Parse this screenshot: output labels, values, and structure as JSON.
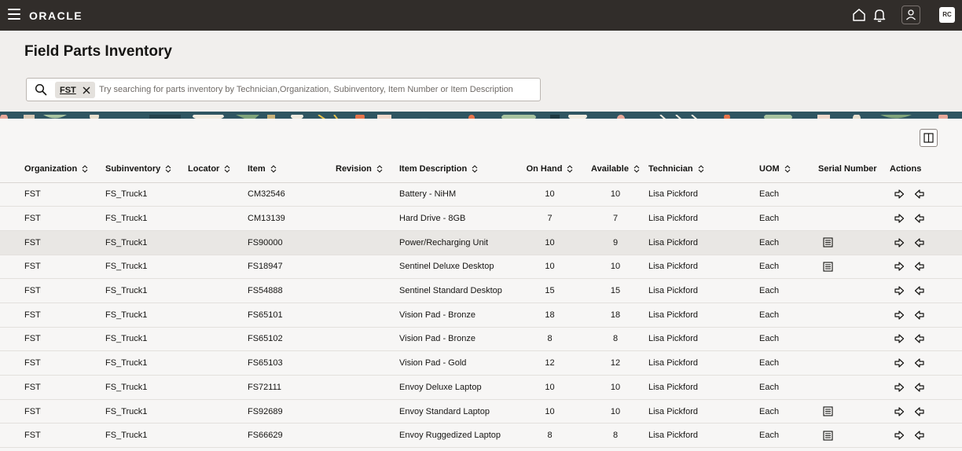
{
  "app": {
    "logo": "ORACLE",
    "avatar_initials": "RC"
  },
  "page": {
    "title": "Field Parts Inventory"
  },
  "search": {
    "chip_label": "FST",
    "placeholder": "Try searching for parts inventory by Technician,Organization, Subinventory, Item Number or Item Description",
    "value": ""
  },
  "table": {
    "headers": {
      "organization": "Organization",
      "subinventory": "Subinventory",
      "locator": "Locator",
      "item": "Item",
      "revision": "Revision",
      "item_description": "Item Description",
      "on_hand": "On Hand",
      "available": "Available",
      "technician": "Technician",
      "uom": "UOM",
      "serial_number": "Serial Number",
      "actions": "Actions"
    },
    "rows": [
      {
        "organization": "FST",
        "subinventory": "FS_Truck1",
        "locator": "",
        "item": "CM32546",
        "revision": "",
        "description": "Battery - NiHM",
        "on_hand": "10",
        "available": "10",
        "technician": "Lisa Pickford",
        "uom": "Each",
        "serial": false
      },
      {
        "organization": "FST",
        "subinventory": "FS_Truck1",
        "locator": "",
        "item": "CM13139",
        "revision": "",
        "description": "Hard Drive - 8GB",
        "on_hand": "7",
        "available": "7",
        "technician": "Lisa Pickford",
        "uom": "Each",
        "serial": false
      },
      {
        "organization": "FST",
        "subinventory": "FS_Truck1",
        "locator": "",
        "item": "FS90000",
        "revision": "",
        "description": "Power/Recharging Unit",
        "on_hand": "10",
        "available": "9",
        "technician": "Lisa Pickford",
        "uom": "Each",
        "serial": true
      },
      {
        "organization": "FST",
        "subinventory": "FS_Truck1",
        "locator": "",
        "item": "FS18947",
        "revision": "",
        "description": "Sentinel Deluxe Desktop",
        "on_hand": "10",
        "available": "10",
        "technician": "Lisa Pickford",
        "uom": "Each",
        "serial": true
      },
      {
        "organization": "FST",
        "subinventory": "FS_Truck1",
        "locator": "",
        "item": "FS54888",
        "revision": "",
        "description": "Sentinel Standard Desktop",
        "on_hand": "15",
        "available": "15",
        "technician": "Lisa Pickford",
        "uom": "Each",
        "serial": false
      },
      {
        "organization": "FST",
        "subinventory": "FS_Truck1",
        "locator": "",
        "item": "FS65101",
        "revision": "",
        "description": "Vision Pad - Bronze",
        "on_hand": "18",
        "available": "18",
        "technician": "Lisa Pickford",
        "uom": "Each",
        "serial": false
      },
      {
        "organization": "FST",
        "subinventory": "FS_Truck1",
        "locator": "",
        "item": "FS65102",
        "revision": "",
        "description": "Vision Pad - Bronze",
        "on_hand": "8",
        "available": "8",
        "technician": "Lisa Pickford",
        "uom": "Each",
        "serial": false
      },
      {
        "organization": "FST",
        "subinventory": "FS_Truck1",
        "locator": "",
        "item": "FS65103",
        "revision": "",
        "description": "Vision Pad - Gold",
        "on_hand": "12",
        "available": "12",
        "technician": "Lisa Pickford",
        "uom": "Each",
        "serial": false
      },
      {
        "organization": "FST",
        "subinventory": "FS_Truck1",
        "locator": "",
        "item": "FS72111",
        "revision": "",
        "description": "Envoy Deluxe Laptop",
        "on_hand": "10",
        "available": "10",
        "technician": "Lisa Pickford",
        "uom": "Each",
        "serial": false
      },
      {
        "organization": "FST",
        "subinventory": "FS_Truck1",
        "locator": "",
        "item": "FS92689",
        "revision": "",
        "description": "Envoy Standard Laptop",
        "on_hand": "10",
        "available": "10",
        "technician": "Lisa Pickford",
        "uom": "Each",
        "serial": true
      },
      {
        "organization": "FST",
        "subinventory": "FS_Truck1",
        "locator": "",
        "item": "FS66629",
        "revision": "",
        "description": "Envoy Ruggedized Laptop",
        "on_hand": "8",
        "available": "8",
        "technician": "Lisa Pickford",
        "uom": "Each",
        "serial": true
      }
    ]
  },
  "colors": {
    "topbar": "#312d2a",
    "page_bg": "#f1efed",
    "selected_row": "#e9e7e4"
  },
  "icons": {
    "menu": "hamburger-icon",
    "home": "home-icon",
    "notifications": "bell-icon",
    "user": "user-icon",
    "search": "search-icon",
    "chip_remove": "close-icon",
    "columns": "columns-icon",
    "sort": "sort-icon",
    "serial": "serial-list-icon",
    "transfer_out": "arrow-right-icon",
    "transfer_in": "arrow-left-icon"
  }
}
